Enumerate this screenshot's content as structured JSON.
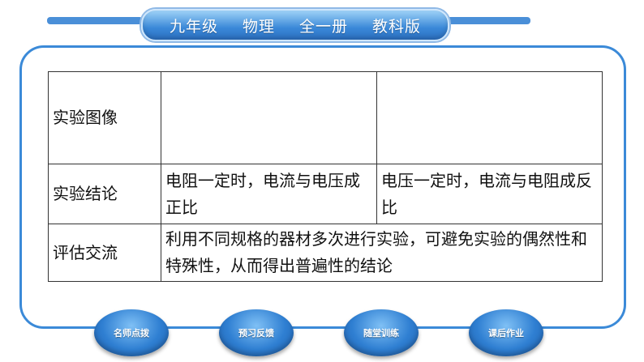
{
  "header": {
    "grade": "九年级",
    "subject": "物理",
    "volume": "全一册",
    "edition": "教科版"
  },
  "table": {
    "rows": [
      {
        "label": "实验图像",
        "cells": [
          "",
          ""
        ]
      },
      {
        "label": "实验结论",
        "cells": [
          "电阻一定时，电流与电压成正比",
          "电压一定时，电流与电阻成反比"
        ]
      },
      {
        "label": "评估交流",
        "merged": "利用不同规格的器材多次进行实验，可避免实验的偶然性和特殊性，从而得出普遍性的结论"
      }
    ]
  },
  "nav": {
    "teacher_tips": "名师点拨",
    "preview_feedback": "预习反馈",
    "class_training": "随堂训练",
    "homework": "课后作业"
  },
  "colors": {
    "accent": "#3b8ad8",
    "banner_text": "#ffffff"
  }
}
